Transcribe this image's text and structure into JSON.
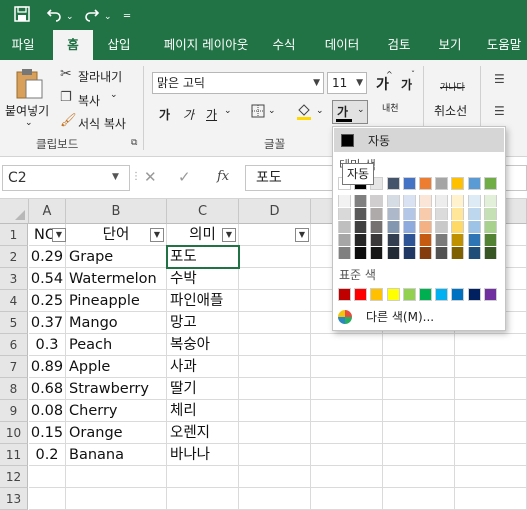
{
  "titlebar": {
    "save_icon": "save-icon",
    "undo_icon": "undo-icon",
    "redo_icon": "redo-icon",
    "customize_icon": "customize-icon"
  },
  "tabs": [
    {
      "label": "파일"
    },
    {
      "label": "홈",
      "active": true
    },
    {
      "label": "삽입"
    },
    {
      "label": "페이지 레이아웃"
    },
    {
      "label": "수식"
    },
    {
      "label": "데이터"
    },
    {
      "label": "검토"
    },
    {
      "label": "보기"
    },
    {
      "label": "도움말"
    }
  ],
  "clipboard": {
    "paste": "붙여넣기",
    "cut": "잘라내기",
    "copy": "복사",
    "format_painter": "서식 복사",
    "group": "클립보드"
  },
  "font": {
    "name": "맑은 고딕",
    "size": "11",
    "group": "글꼴",
    "grow": "가",
    "shrink": "가",
    "bold": "가",
    "italic": "가",
    "underline": "가",
    "color_letter": "가",
    "phonetic": "내천"
  },
  "strike": {
    "label": "취소선",
    "sample": "가나다"
  },
  "formula_bar": {
    "name_box": "C2",
    "value": "포도",
    "cancel": "✕",
    "enter": "✓",
    "fx": "fx"
  },
  "columns": [
    "A",
    "B",
    "C",
    "D"
  ],
  "rows": [
    "1",
    "2",
    "3",
    "4",
    "5",
    "6",
    "7",
    "8",
    "9",
    "10",
    "11",
    "12",
    "13"
  ],
  "headers": [
    "NO",
    "단어",
    "의미",
    ""
  ],
  "data": [
    {
      "no": "0.29",
      "word": "Grape",
      "meaning": "포도"
    },
    {
      "no": "0.54",
      "word": "Watermelon",
      "meaning": "수박"
    },
    {
      "no": "0.25",
      "word": "Pineapple",
      "meaning": "파인애플"
    },
    {
      "no": "0.37",
      "word": "Mango",
      "meaning": "망고"
    },
    {
      "no": "0.3",
      "word": "Peach",
      "meaning": "복숭아"
    },
    {
      "no": "0.89",
      "word": "Apple",
      "meaning": "사과"
    },
    {
      "no": "0.68",
      "word": "Strawberry",
      "meaning": "딸기"
    },
    {
      "no": "0.08",
      "word": "Cherry",
      "meaning": "체리"
    },
    {
      "no": "0.15",
      "word": "Orange",
      "meaning": "오렌지"
    },
    {
      "no": "0.2",
      "word": "Banana",
      "meaning": "바나나"
    }
  ],
  "color_dropdown": {
    "auto_label": "자동",
    "theme_label": "테마 색",
    "standard_label": "표준 색",
    "more_label": "다른 색(M)...",
    "tooltip": "자동",
    "theme_top": [
      "#ffffff",
      "#000000",
      "#e7e6e6",
      "#44546a",
      "#4472c4",
      "#ed7d31",
      "#a5a5a5",
      "#ffc000",
      "#5b9bd5",
      "#70ad47"
    ],
    "theme_shades": [
      [
        "#f2f2f2",
        "#808080",
        "#d0cece",
        "#d6dce4",
        "#d9e2f3",
        "#fbe5d6",
        "#ededed",
        "#fff2cc",
        "#ddebf7",
        "#e2efd9"
      ],
      [
        "#d9d9d9",
        "#595959",
        "#aeaaaa",
        "#adb9ca",
        "#b4c7e7",
        "#f8cbad",
        "#dbdbdb",
        "#ffe699",
        "#bdd7ee",
        "#c5e0b4"
      ],
      [
        "#bfbfbf",
        "#404040",
        "#757171",
        "#8497b0",
        "#8faadc",
        "#f4b183",
        "#c9c9c9",
        "#ffd966",
        "#9dc3e6",
        "#a9d18e"
      ],
      [
        "#a6a6a6",
        "#262626",
        "#3a3838",
        "#333f50",
        "#2f5597",
        "#c55a11",
        "#7b7b7b",
        "#bf9000",
        "#2e75b6",
        "#548235"
      ],
      [
        "#808080",
        "#0d0d0d",
        "#171616",
        "#222a35",
        "#203864",
        "#843c0c",
        "#525252",
        "#7f6000",
        "#1f4e79",
        "#375623"
      ]
    ],
    "standard": [
      "#c00000",
      "#ff0000",
      "#ffc000",
      "#ffff00",
      "#92d050",
      "#00b050",
      "#00b0f0",
      "#0070c0",
      "#002060",
      "#7030a0"
    ]
  }
}
